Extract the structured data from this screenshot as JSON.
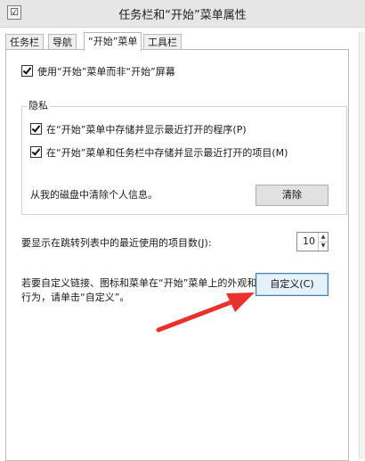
{
  "window": {
    "title": "任务栏和“开始”菜单属性"
  },
  "tabs": [
    {
      "label": "任务栏"
    },
    {
      "label": "导航"
    },
    {
      "label": "“开始”菜单"
    },
    {
      "label": "工具栏"
    }
  ],
  "start_menu": {
    "use_start_screen": "使用“开始”菜单而非“开始”屏幕",
    "privacy": {
      "title": "隐私",
      "store_recent_programs": "在“开始”菜单中存储并显示最近打开的程序(P)",
      "store_recent_items": "在“开始”菜单和任务栏中存储并显示最近打开的项目(M)",
      "clear_label": "从我的磁盘中清除个人信息。",
      "clear_button": "清除"
    },
    "jumplist_label": "要显示在跳转列表中的最近使用的项目数(J):",
    "jumplist_count": "10",
    "customize_text_line1": "若要自定义链接、图标和菜单在“开始”菜单上的外观和",
    "customize_text_line2": "行为，请单击“自定义”。",
    "customize_button": "自定义(C)"
  },
  "annotation": {
    "arrow_color": "#e8322b"
  }
}
